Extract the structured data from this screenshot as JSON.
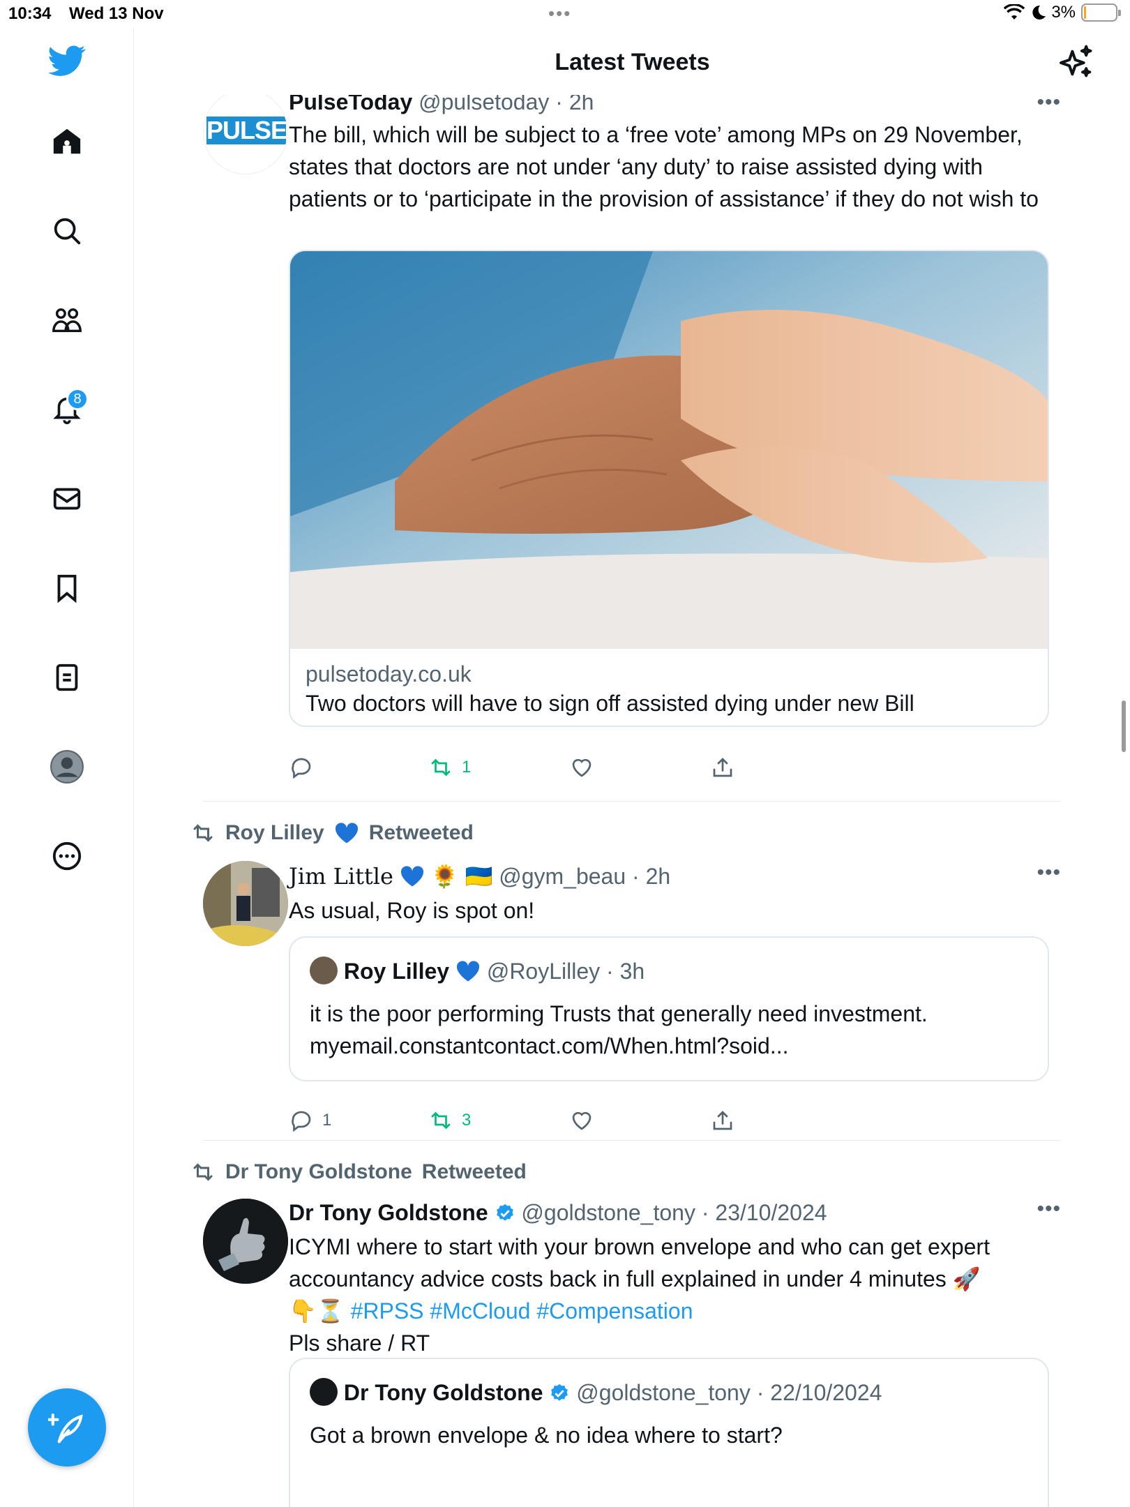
{
  "status_bar": {
    "time": "10:34",
    "date": "Wed 13 Nov",
    "battery": "3%",
    "battery_level": 0.03
  },
  "header": {
    "title": "Latest Tweets"
  },
  "sidebar": {
    "items": [
      {
        "name": "home",
        "icon": "home-icon"
      },
      {
        "name": "search",
        "icon": "search-icon"
      },
      {
        "name": "communities",
        "icon": "people-icon"
      },
      {
        "name": "notifications",
        "icon": "bell-icon",
        "badge": "8"
      },
      {
        "name": "messages",
        "icon": "envelope-icon"
      },
      {
        "name": "bookmarks",
        "icon": "bookmark-icon"
      },
      {
        "name": "lists",
        "icon": "list-icon"
      },
      {
        "name": "profile",
        "icon": "avatar-icon"
      },
      {
        "name": "more",
        "icon": "more-circle-icon"
      }
    ]
  },
  "colors": {
    "accent": "#1d9bf0",
    "retweet_green": "#00ba7c",
    "muted": "#536471"
  },
  "tweets": [
    {
      "name": "PulseToday",
      "handle": "@pulsetoday",
      "time": "2h",
      "avatar_text": "PULSE",
      "text": "The bill, which will be subject to a ‘free vote’ among MPs on 29 November, states that doctors are not under ‘any duty’ to raise assisted dying with patients or to ‘participate in the provision of assistance’ if they do not wish to",
      "card": {
        "domain": "pulsetoday.co.uk",
        "title": "Two doctors will have to sign off assisted dying under new Bill"
      },
      "retweets": "1"
    },
    {
      "retweeted_by": "Roy Lilley",
      "retweeted_label": "Retweeted",
      "name": "Jim Little",
      "emoji": "🌻 🇺🇦",
      "handle": "@gym_beau",
      "time": "2h",
      "text": "As usual, Roy is spot on!",
      "quote": {
        "name": "Roy Lilley",
        "handle": "@RoyLilley",
        "time": "3h",
        "text": "it is the poor performing Trusts that generally need investment. myemail.constantcontact.com/When.html?soid..."
      },
      "replies": "1",
      "retweets": "3"
    },
    {
      "retweeted_by": "Dr Tony Goldstone",
      "retweeted_label": "Retweeted",
      "name": "Dr Tony Goldstone",
      "handle": "@goldstone_tony",
      "time": "23/10/2024",
      "text": "ICYMI where to start with your brown envelope and who can get expert accountancy advice costs back in full explained in under 4 minutes 🚀",
      "text2_emoji": "👇⏳",
      "hashtags": "#RPSS #McCloud #Compensation",
      "text3": "Pls share / RT",
      "quote": {
        "name": "Dr Tony Goldstone",
        "handle": "@goldstone_tony",
        "time": "22/10/2024",
        "text": "Got a brown envelope & no idea where to start?"
      }
    }
  ]
}
